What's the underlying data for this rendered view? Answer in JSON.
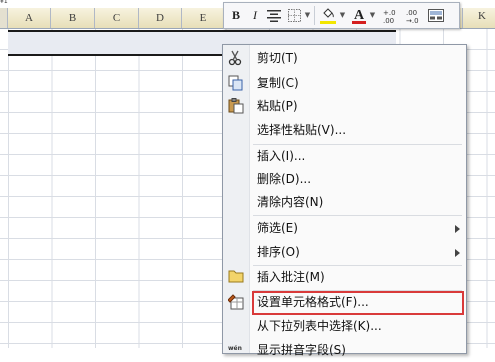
{
  "sheet": {
    "top_cut_text": "¥1",
    "columns": [
      "A",
      "B",
      "C",
      "D",
      "E"
    ],
    "right_column": "K"
  },
  "mini_toolbar": {
    "bold": "B",
    "italic": "I",
    "font_color_letter": "A",
    "increase_decimal": "+.0\n.00",
    "decrease_decimal": ".00\n→.0",
    "highlight_color": "#f2e600",
    "font_color": "#d41f1f"
  },
  "context_menu": {
    "items": [
      {
        "label": "剪切(T)",
        "icon": "scissors-icon"
      },
      {
        "label": "复制(C)",
        "icon": "copy-icon"
      },
      {
        "label": "粘贴(P)",
        "icon": "paste-icon"
      },
      {
        "label": "选择性粘贴(V)...",
        "icon": ""
      },
      {
        "label": "插入(I)...",
        "icon": ""
      },
      {
        "label": "删除(D)...",
        "icon": ""
      },
      {
        "label": "清除内容(N)",
        "icon": ""
      },
      {
        "label": "筛选(E)",
        "icon": "",
        "submenu": true
      },
      {
        "label": "排序(O)",
        "icon": "",
        "submenu": true
      },
      {
        "label": "插入批注(M)",
        "icon": "comment-icon"
      },
      {
        "label": "设置单元格格式(F)...",
        "icon": "format-cells-icon"
      },
      {
        "label": "从下拉列表中选择(K)...",
        "icon": ""
      },
      {
        "label": "显示拼音字段(S)",
        "icon": "phonetic-icon"
      }
    ],
    "highlight_color": "#d93a3a"
  }
}
